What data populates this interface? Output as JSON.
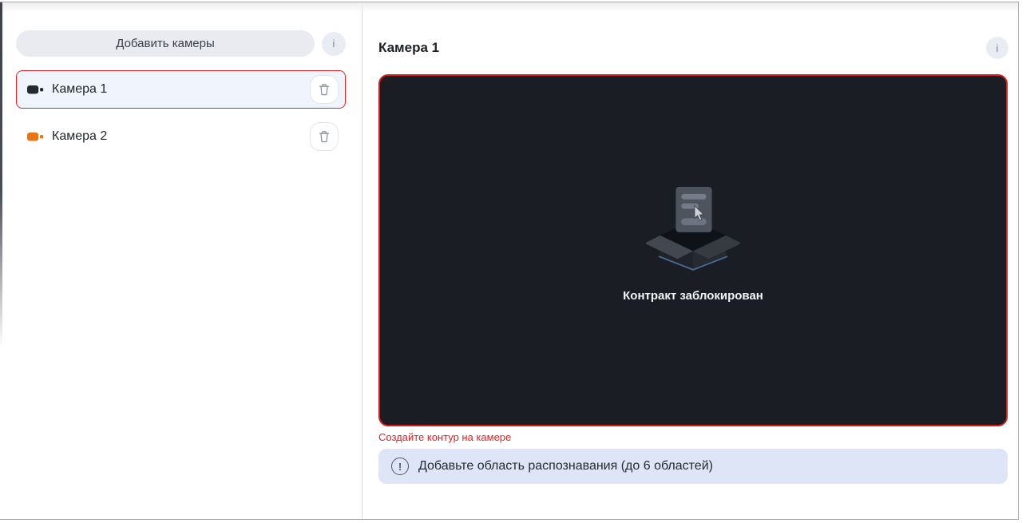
{
  "sidebar": {
    "add_button_label": "Добавить камеры",
    "info_icon_label": "i",
    "cameras": [
      {
        "name": "Камера 1",
        "selected": "true",
        "icon_color": "#26292f"
      },
      {
        "name": "Камера 2",
        "selected": "false",
        "icon_color": "#e87514"
      }
    ]
  },
  "main": {
    "title": "Камера 1",
    "info_icon_label": "i",
    "placeholder_text": "Контракт заблокирован",
    "error_text": "Создайте контур на камере",
    "notice_icon": "!",
    "notice_text": "Добавьте область распознавания (до 6 областей)"
  },
  "colors": {
    "accent_red": "#e02424",
    "video_border_red": "#d21d1d",
    "selected_row_bg": "#f0f5fd",
    "notice_bg": "#dde5f6",
    "video_bg": "#1a1d23",
    "button_bg": "#e9ebf1"
  }
}
